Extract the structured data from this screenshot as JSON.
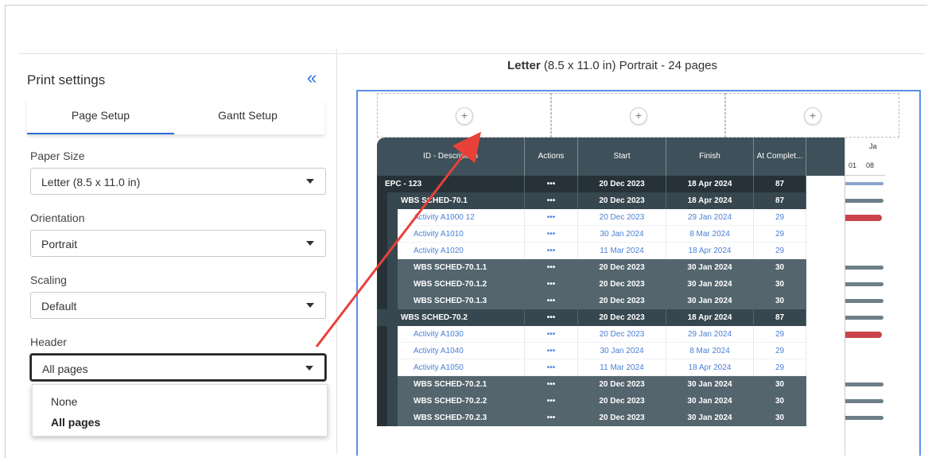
{
  "panel": {
    "title": "Print settings",
    "tabs": [
      {
        "label": "Page Setup",
        "active": true
      },
      {
        "label": "Gantt Setup",
        "active": false
      }
    ],
    "fields": [
      {
        "label": "Paper Size",
        "value": "Letter (8.5 x 11.0 in)"
      },
      {
        "label": "Orientation",
        "value": "Portrait"
      },
      {
        "label": "Scaling",
        "value": "Default"
      },
      {
        "label": "Header",
        "value": "All pages"
      }
    ],
    "dropdown_options": [
      {
        "label": "None",
        "selected": false
      },
      {
        "label": "All pages",
        "selected": true
      }
    ]
  },
  "preview": {
    "title_bold": "Letter",
    "title_rest": " (8.5 x 11.0 in) Portrait - 24 pages",
    "columns": [
      "ID - Description",
      "Actions",
      "Start",
      "Finish",
      "At Complet..."
    ],
    "gantt_month": "Ja",
    "gantt_days": [
      "01",
      "08"
    ],
    "rows": [
      {
        "type": "epc",
        "desc": "EPC - 123",
        "actions": "•••",
        "start": "20 Dec 2023",
        "finish": "18 Apr 2024",
        "at": "87"
      },
      {
        "type": "wbs",
        "desc": "WBS SCHED-70.1",
        "actions": "•••",
        "start": "20 Dec 2023",
        "finish": "18 Apr 2024",
        "at": "87"
      },
      {
        "type": "act",
        "desc": "Activity A1000 12",
        "actions": "•••",
        "start": "20 Dec 2023",
        "finish": "29 Jan 2024",
        "at": "29"
      },
      {
        "type": "act",
        "desc": "Activity A1010",
        "actions": "•••",
        "start": "30 Jan 2024",
        "finish": "8 Mar 2024",
        "at": "29"
      },
      {
        "type": "act",
        "desc": "Activity A1020",
        "actions": "•••",
        "start": "11 Mar 2024",
        "finish": "18 Apr 2024",
        "at": "29"
      },
      {
        "type": "sub",
        "desc": "WBS SCHED-70.1.1",
        "actions": "•••",
        "start": "20 Dec 2023",
        "finish": "30 Jan 2024",
        "at": "30"
      },
      {
        "type": "sub",
        "desc": "WBS SCHED-70.1.2",
        "actions": "•••",
        "start": "20 Dec 2023",
        "finish": "30 Jan 2024",
        "at": "30"
      },
      {
        "type": "sub",
        "desc": "WBS SCHED-70.1.3",
        "actions": "•••",
        "start": "20 Dec 2023",
        "finish": "30 Jan 2024",
        "at": "30"
      },
      {
        "type": "wbs2",
        "desc": "WBS SCHED-70.2",
        "actions": "•••",
        "start": "20 Dec 2023",
        "finish": "18 Apr 2024",
        "at": "87"
      },
      {
        "type": "act",
        "desc": "Activity A1030",
        "actions": "•••",
        "start": "20 Dec 2023",
        "finish": "29 Jan 2024",
        "at": "29"
      },
      {
        "type": "act",
        "desc": "Activity A1040",
        "actions": "•••",
        "start": "30 Jan 2024",
        "finish": "8 Mar 2024",
        "at": "29"
      },
      {
        "type": "act",
        "desc": "Activity A1050",
        "actions": "•••",
        "start": "11 Mar 2024",
        "finish": "18 Apr 2024",
        "at": "29"
      },
      {
        "type": "sub",
        "desc": "WBS SCHED-70.2.1",
        "actions": "•••",
        "start": "20 Dec 2023",
        "finish": "30 Jan 2024",
        "at": "30"
      },
      {
        "type": "sub",
        "desc": "WBS SCHED-70.2.2",
        "actions": "•••",
        "start": "20 Dec 2023",
        "finish": "30 Jan 2024",
        "at": "30"
      },
      {
        "type": "sub",
        "desc": "WBS SCHED-70.2.3",
        "actions": "•••",
        "start": "20 Dec 2023",
        "finish": "30 Jan 2024",
        "at": "30"
      }
    ]
  },
  "colors": {
    "accent": "#2a6ed8",
    "annotation_arrow": "#e8413a",
    "grid_header": "#3e5059"
  }
}
